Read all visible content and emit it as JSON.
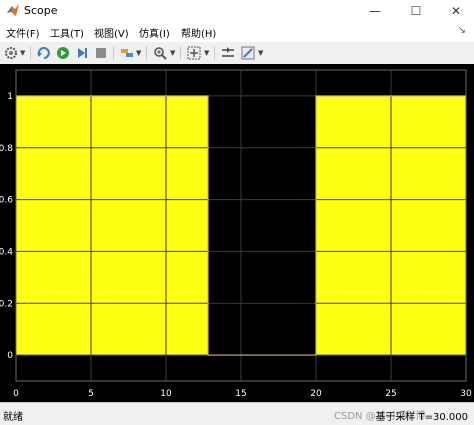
{
  "window": {
    "title": "Scope",
    "minimize": "—",
    "maximize": "☐",
    "close": "✕"
  },
  "menu": {
    "items": [
      "文件(F)",
      "工具(T)",
      "视图(V)",
      "仿真(I)",
      "帮助(H)"
    ],
    "pin": "↘"
  },
  "toolbar": {
    "items": [
      "settings-icon",
      "open-icon",
      "run-icon",
      "step-forward-icon",
      "stop-icon",
      "highlight-icon",
      "zoom-icon",
      "fit-icon",
      "cursor-icon",
      "style-icon"
    ]
  },
  "chart_data": {
    "type": "area",
    "x": [
      0,
      12.8,
      12.8,
      20,
      20,
      30
    ],
    "y": [
      1,
      1,
      0,
      0,
      1,
      1
    ],
    "xlim": [
      0,
      30
    ],
    "ylim": [
      -0.1,
      1.1
    ],
    "xticks": [
      "0",
      "5",
      "10",
      "15",
      "20",
      "25",
      "30"
    ],
    "yticks": [
      "0",
      "0.2",
      "0.4",
      "0.6",
      "0.8",
      "1"
    ],
    "grid": true,
    "colors": {
      "fill": "#ffff14",
      "background": "#000000",
      "grid": "#3c3c3c",
      "axis_text": "#ffffff"
    }
  },
  "status": {
    "left": "就绪",
    "watermark": "CSDN @ 小小 的 博",
    "right": "基于采样 T=30.000"
  }
}
